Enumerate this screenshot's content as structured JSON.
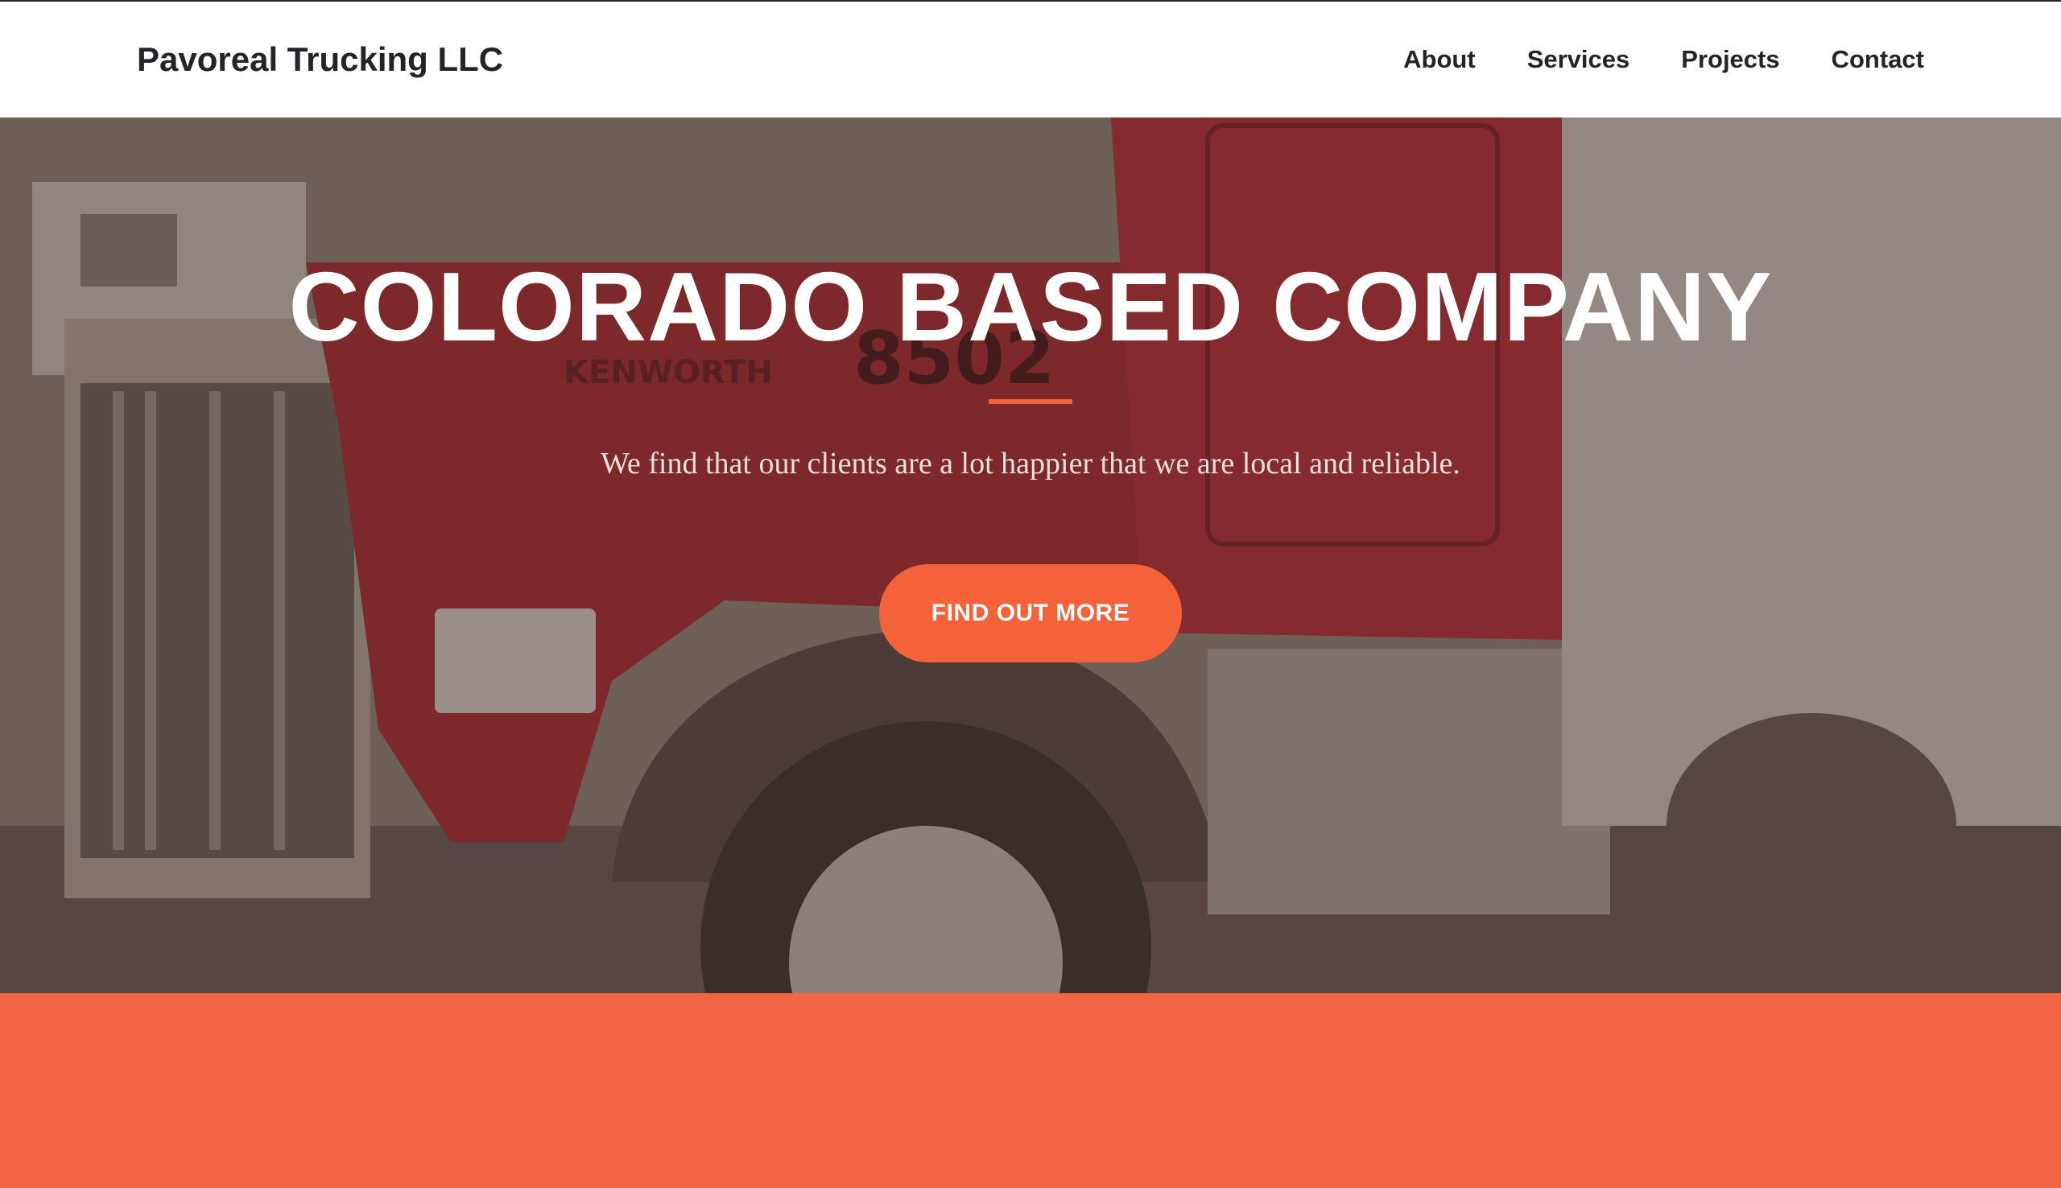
{
  "navbar": {
    "brand": "Pavoreal Trucking LLC",
    "links": [
      {
        "label": "About"
      },
      {
        "label": "Services"
      },
      {
        "label": "Projects"
      },
      {
        "label": "Contact"
      }
    ]
  },
  "hero": {
    "title": "COLORADO BASED COMPANY",
    "subtitle": "We find that our clients are a lot happier that we are local and reliable.",
    "cta_label": "FIND OUT MORE",
    "background_image": {
      "description_icon": "red-truck-photo",
      "visible_text": [
        "KENWORTH",
        "8502"
      ]
    }
  },
  "colors": {
    "accent": "#f4623a",
    "text_dark": "#212529",
    "section_band": "#f26442"
  }
}
